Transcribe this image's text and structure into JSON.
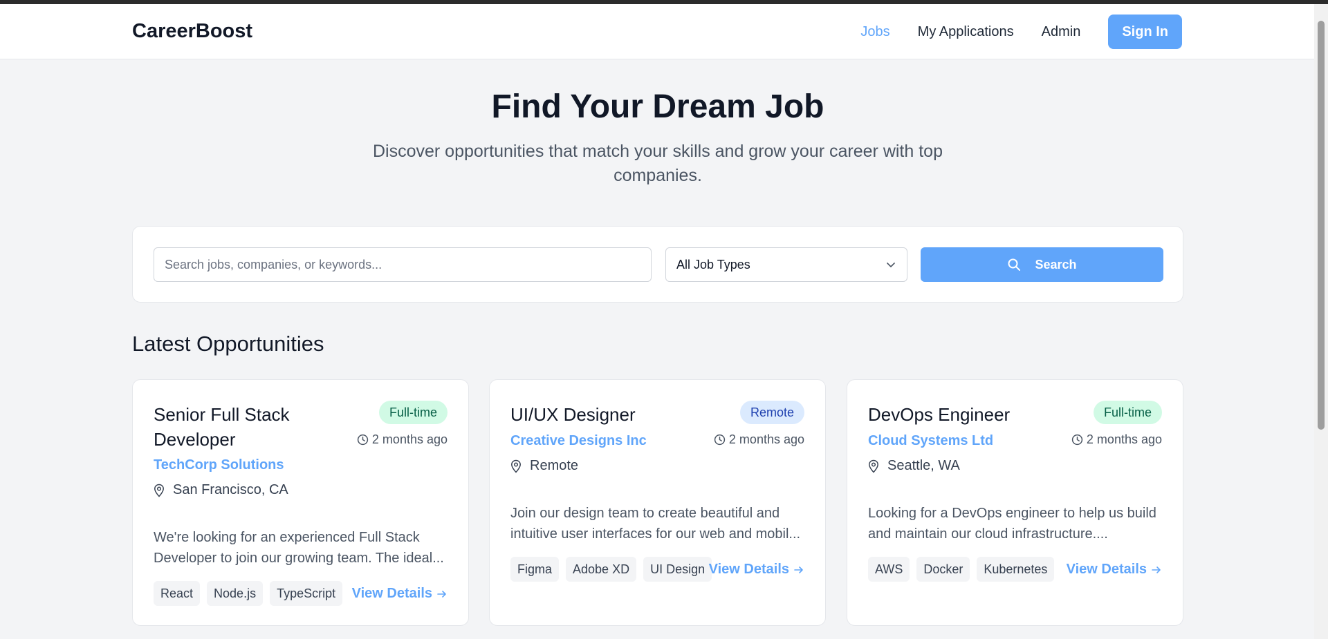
{
  "header": {
    "brand": "CareerBoost",
    "nav": [
      "Jobs",
      "My Applications",
      "Admin"
    ],
    "active_nav": "Jobs",
    "sign_in": "Sign In"
  },
  "hero": {
    "title": "Find Your Dream Job",
    "subtitle": "Discover opportunities that match your skills and grow your career with top companies."
  },
  "search": {
    "placeholder": "Search jobs, companies, or keywords...",
    "value": "",
    "job_type": "All Job Types",
    "button": "Search"
  },
  "section_title": "Latest Opportunities",
  "jobs": [
    {
      "title": "Senior Full Stack Developer",
      "type": "Full-time",
      "posted": "2 months ago",
      "company": "TechCorp Solutions",
      "location": "San Francisco, CA",
      "description_line1": "We're looking for an experienced Full Stack",
      "description_line2": "Developer to join our growing team. The ideal...",
      "tags": [
        "React",
        "Node.js",
        "TypeScript"
      ],
      "link": "View Details"
    },
    {
      "title": "UI/UX Designer",
      "type": "Remote",
      "posted": "2 months ago",
      "company": "Creative Designs Inc",
      "location": "Remote",
      "description_line1": "Join our design team to create beautiful and",
      "description_line2": "intuitive user interfaces for our web and mobil...",
      "tags": [
        "Figma",
        "Adobe XD",
        "UI Design"
      ],
      "link": "View Details"
    },
    {
      "title": "DevOps Engineer",
      "type": "Full-time",
      "posted": "2 months ago",
      "company": "Cloud Systems Ltd",
      "location": "Seattle, WA",
      "description_line1": "Looking for a DevOps engineer to help us build",
      "description_line2": "and maintain our cloud infrastructure....",
      "tags": [
        "AWS",
        "Docker",
        "Kubernetes"
      ],
      "link": "View Details"
    }
  ],
  "colors": {
    "accent": "#60a5fa",
    "badge_fulltime_bg": "#d1fae5",
    "badge_remote_bg": "#dbeafe",
    "page_bg": "#f3f4f6"
  },
  "icons": {
    "clock": "clock-icon",
    "location": "map-pin-icon",
    "search": "search-icon",
    "chevron": "chevron-down-icon",
    "arrow": "arrow-right-icon"
  }
}
